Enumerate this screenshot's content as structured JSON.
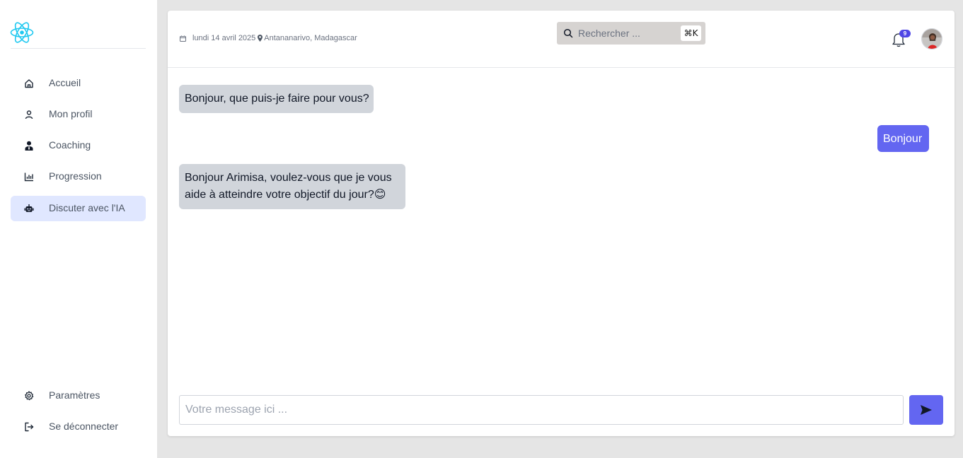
{
  "sidebar": {
    "logo_icon": "react-atom-icon",
    "items": [
      {
        "label": "Accueil",
        "icon": "home-icon"
      },
      {
        "label": "Mon profil",
        "icon": "user-icon"
      },
      {
        "label": "Coaching",
        "icon": "coach-icon"
      },
      {
        "label": "Progression",
        "icon": "bar-chart-icon"
      },
      {
        "label": "Discuter avec l'IA",
        "icon": "robot-icon",
        "active": true
      }
    ],
    "bottom_items": [
      {
        "label": "Paramètres",
        "icon": "gear-icon"
      },
      {
        "label": "Se déconnecter",
        "icon": "logout-icon"
      }
    ]
  },
  "header": {
    "date": "lundi 14 avril 2025",
    "location": "Antananarivo, Madagascar",
    "search_placeholder": "Rechercher ...",
    "search_shortcut": "⌘K",
    "notification_count": "9"
  },
  "chat": {
    "messages": [
      {
        "role": "ai",
        "text": "Bonjour, que puis-je faire pour vous?"
      },
      {
        "role": "user",
        "text": "Bonjour"
      },
      {
        "role": "ai",
        "text": "Bonjour Arimisa, voulez-vous que je vous aide à atteindre votre objectif du jour?😊"
      }
    ],
    "input_placeholder": "Votre message ici ..."
  },
  "colors": {
    "accent": "#6366f1",
    "active_nav_bg": "#e0e7ff",
    "ai_bubble": "#d1d5db",
    "background": "#e5e5e5"
  }
}
